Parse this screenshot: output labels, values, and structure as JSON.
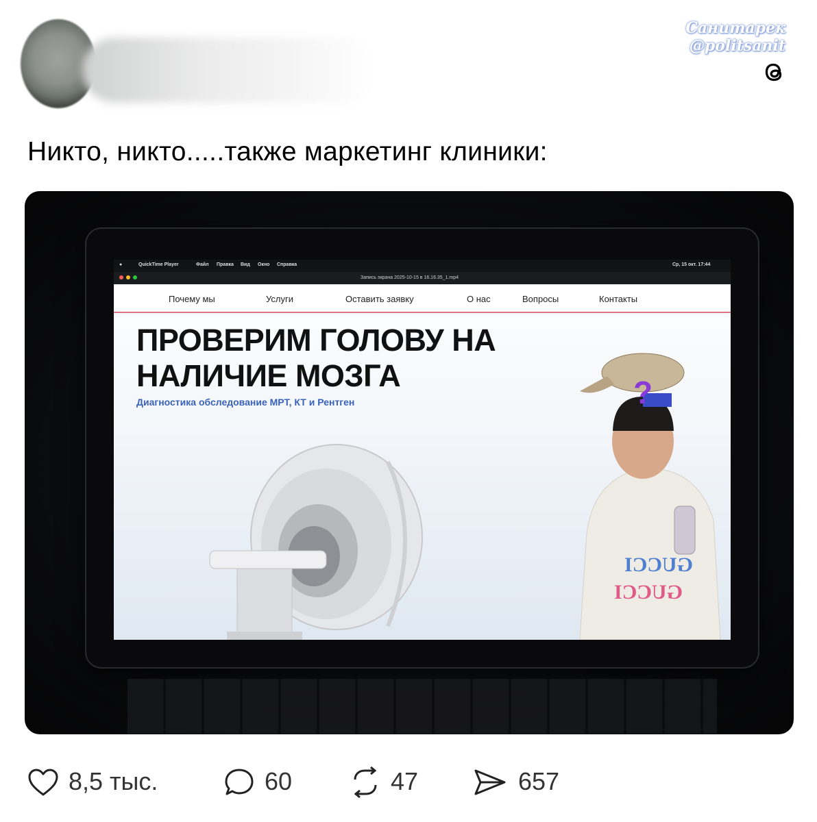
{
  "post": {
    "author_avatar": "blurred-avatar",
    "author_name_blurred": true,
    "caption": "Никто, никто.....также маркетинг клиники:"
  },
  "watermark": {
    "line1": "Санитарек",
    "line2": "@politsanit"
  },
  "icons": {
    "threads": "threads-logo-icon",
    "like": "heart-icon",
    "comment": "comment-bubble-icon",
    "repost": "repost-icon",
    "share": "send-icon"
  },
  "screen": {
    "menubar_items": [
      "QuickTime Player",
      "Файл",
      "Правка",
      "Вид",
      "Окно",
      "Справка"
    ],
    "menubar_clock": "Ср, 15 окт. 17:44",
    "file_title": "Запись экрана 2025-10-15 в 16.16.35_1.mp4",
    "nav": [
      "Почему мы",
      "Услуги",
      "Оставить заявку",
      "О нас",
      "Вопросы",
      "Контакты"
    ],
    "headline_line1": "ПРОВЕРИМ ГОЛОВУ НА",
    "headline_line2": "НАЛИЧИЕ МОЗГА",
    "subheadline": "Диагностика обследование МРТ, КТ и Рентген",
    "question_mark": "?",
    "hoodie_text1": "GUCCI",
    "hoodie_text2": "GUCCI"
  },
  "actions": {
    "likes": "8,5 тыс.",
    "comments": "60",
    "reposts": "47",
    "shares": "657"
  },
  "colors": {
    "accent_nav_line": "#d9737c",
    "subheadline": "#3a62b8",
    "watermark_glow": "#8aa2d8"
  }
}
